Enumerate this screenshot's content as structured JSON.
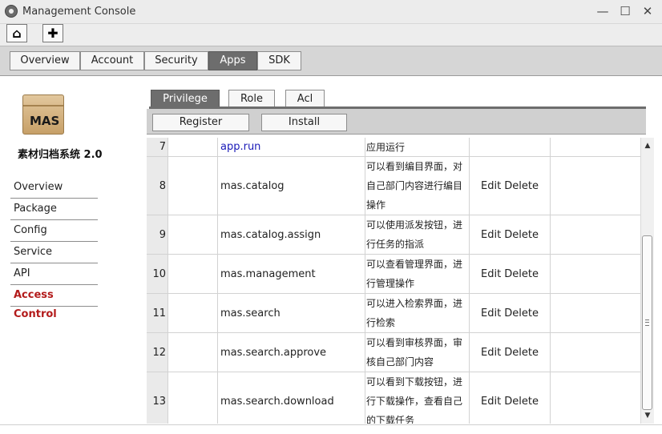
{
  "window": {
    "title": "Management Console",
    "controls": {
      "minimize": "—",
      "maximize": "☐",
      "close": "✕"
    }
  },
  "toolbar": {
    "home_icon": "⌂",
    "add_icon": "✚"
  },
  "main_tabs": [
    "Overview",
    "Account",
    "Security",
    "Apps",
    "SDK"
  ],
  "main_tab_active": "Apps",
  "sidebar": {
    "logo_text": "MAS",
    "app_name": "素材归档系统 2.0",
    "items": [
      "Overview",
      "Package",
      "Config",
      "Service",
      "API",
      "Access Control"
    ],
    "active": "Access Control"
  },
  "sub_tabs": [
    "Privilege",
    "Role",
    "Acl"
  ],
  "sub_tab_active": "Privilege",
  "actions": [
    "Register",
    "Install"
  ],
  "rows": [
    {
      "idx": "7",
      "name": "app.run",
      "desc": [
        "应用运行"
      ],
      "edit": "",
      "delete": ""
    },
    {
      "idx": "8",
      "name": "mas.catalog",
      "desc": [
        "可以看到编目界面，对",
        "自己部门内容进行编目",
        "操作"
      ],
      "edit": "Edit",
      "delete": "Delete"
    },
    {
      "idx": "9",
      "name": "mas.catalog.assign",
      "desc": [
        "可以使用派发按钮，进",
        "行任务的指派"
      ],
      "edit": "Edit",
      "delete": "Delete"
    },
    {
      "idx": "10",
      "name": "mas.management",
      "desc": [
        "可以查看管理界面，进",
        "行管理操作"
      ],
      "edit": "Edit",
      "delete": "Delete"
    },
    {
      "idx": "11",
      "name": "mas.search",
      "desc": [
        "可以进入检索界面，进",
        "行检索"
      ],
      "edit": "Edit",
      "delete": "Delete"
    },
    {
      "idx": "12",
      "name": "mas.search.approve",
      "desc": [
        "可以看到审核界面，审",
        "核自己部门内容"
      ],
      "edit": "Edit",
      "delete": "Delete"
    },
    {
      "idx": "13",
      "name": "mas.search.download",
      "desc": [
        "可以看到下载按钮，进",
        "行下载操作，查看自己",
        "的下载任务"
      ],
      "edit": "Edit",
      "delete": "Delete"
    }
  ],
  "scrollbar": {
    "up": "▲",
    "down": "▼"
  }
}
